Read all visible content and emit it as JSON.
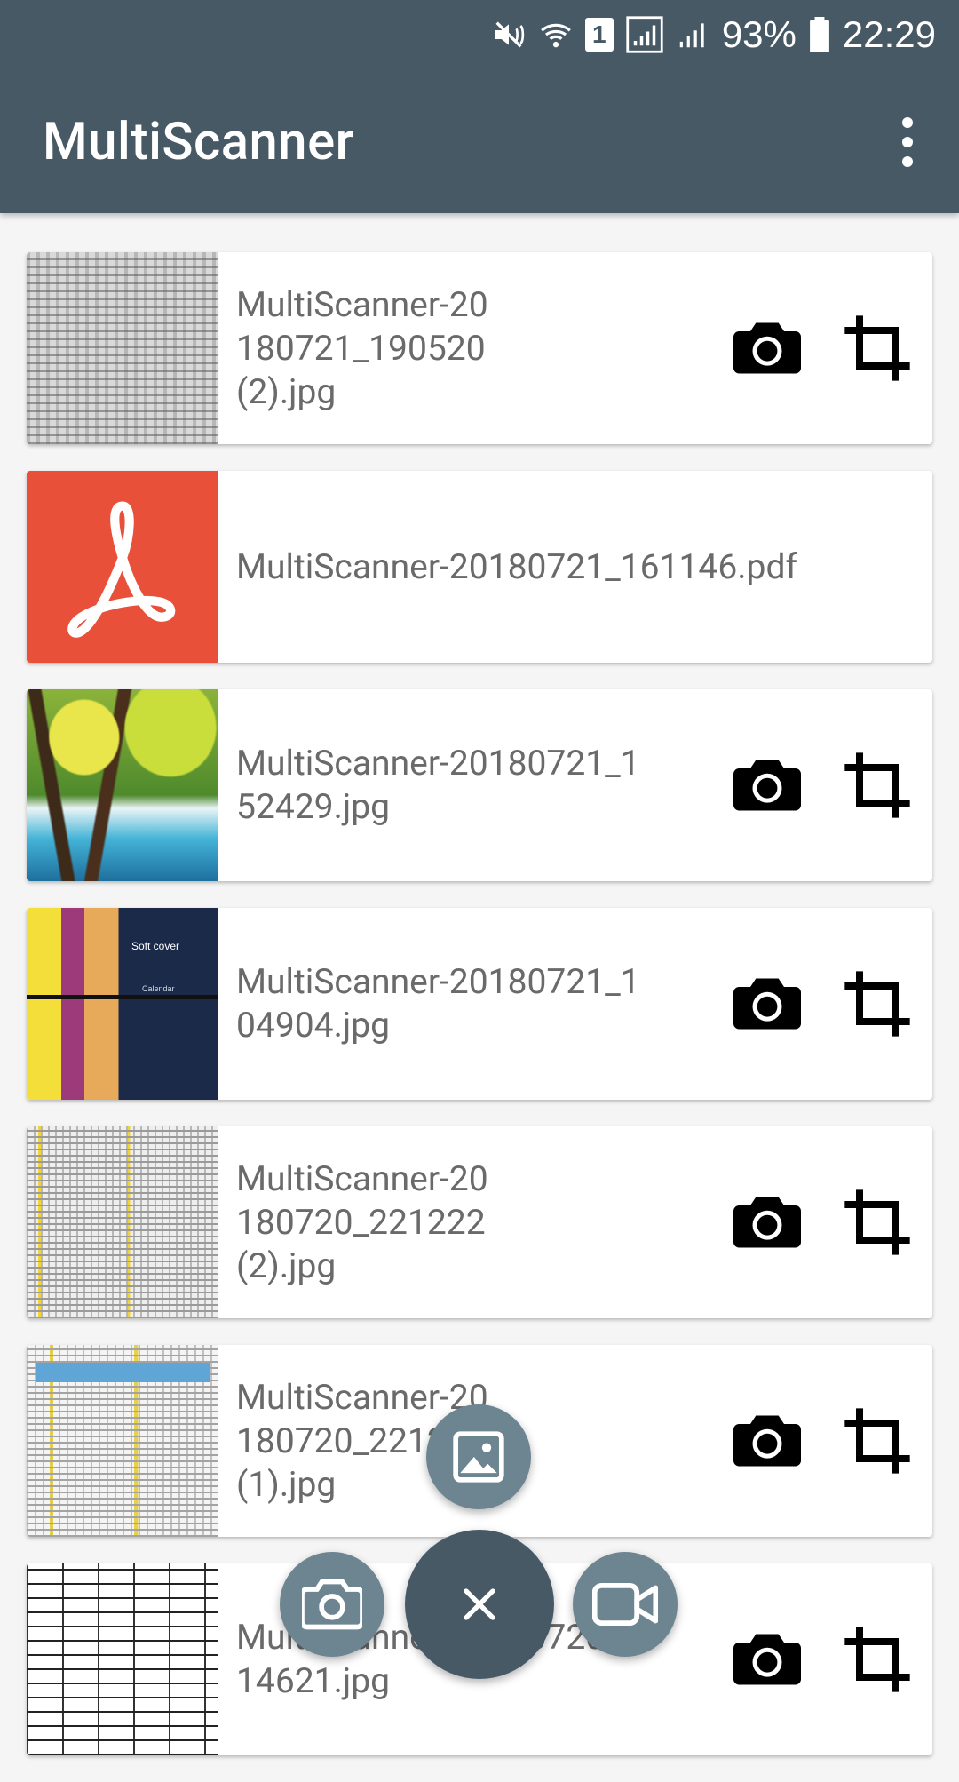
{
  "status_bar": {
    "sim_number": "1",
    "battery_percent": "93%",
    "time": "22:29"
  },
  "app_bar": {
    "title": "MultiScanner"
  },
  "files": [
    {
      "name": "MultiScanner-20180721_190520 (2).jpg",
      "display": "MultiScanner-20\n180721_190520\n(2).jpg",
      "thumb": "doc",
      "has_actions": true
    },
    {
      "name": "MultiScanner-20180721_161146.pdf",
      "display": "MultiScanner-20180721_161146.pdf",
      "thumb": "pdf",
      "has_actions": false
    },
    {
      "name": "MultiScanner-20180721_152429.jpg",
      "display": "MultiScanner-20180721_1\n52429.jpg",
      "thumb": "nature",
      "has_actions": true
    },
    {
      "name": "MultiScanner-20180721_104904.jpg",
      "display": "MultiScanner-20180721_1\n04904.jpg",
      "thumb": "cover",
      "has_actions": true
    },
    {
      "name": "MultiScanner-20180720_221222 (2).jpg",
      "display": "MultiScanner-20\n180720_221222\n(2).jpg",
      "thumb": "table",
      "has_actions": true
    },
    {
      "name": "MultiScanner-20180720_221222 (1).jpg",
      "display": "MultiScanner-20\n180720_221222\n(1).jpg",
      "thumb": "table2",
      "has_actions": true
    },
    {
      "name": "MultiScanner-20180720_214621.jpg",
      "display": "MultiScanner-20180720_2\n14621.jpg",
      "thumb": "form",
      "has_actions": true
    }
  ],
  "thumb_texts": {
    "cover_title": "Soft cover",
    "cover_sub": "Calendar"
  },
  "fab_menu": {
    "main": "×",
    "gallery_icon": "image-icon",
    "camera_icon": "camera-icon",
    "video_icon": "video-camera-icon"
  },
  "colors": {
    "app_bar": "#465965",
    "fab_secondary": "#6d8591",
    "pdf_red": "#e9503a"
  }
}
